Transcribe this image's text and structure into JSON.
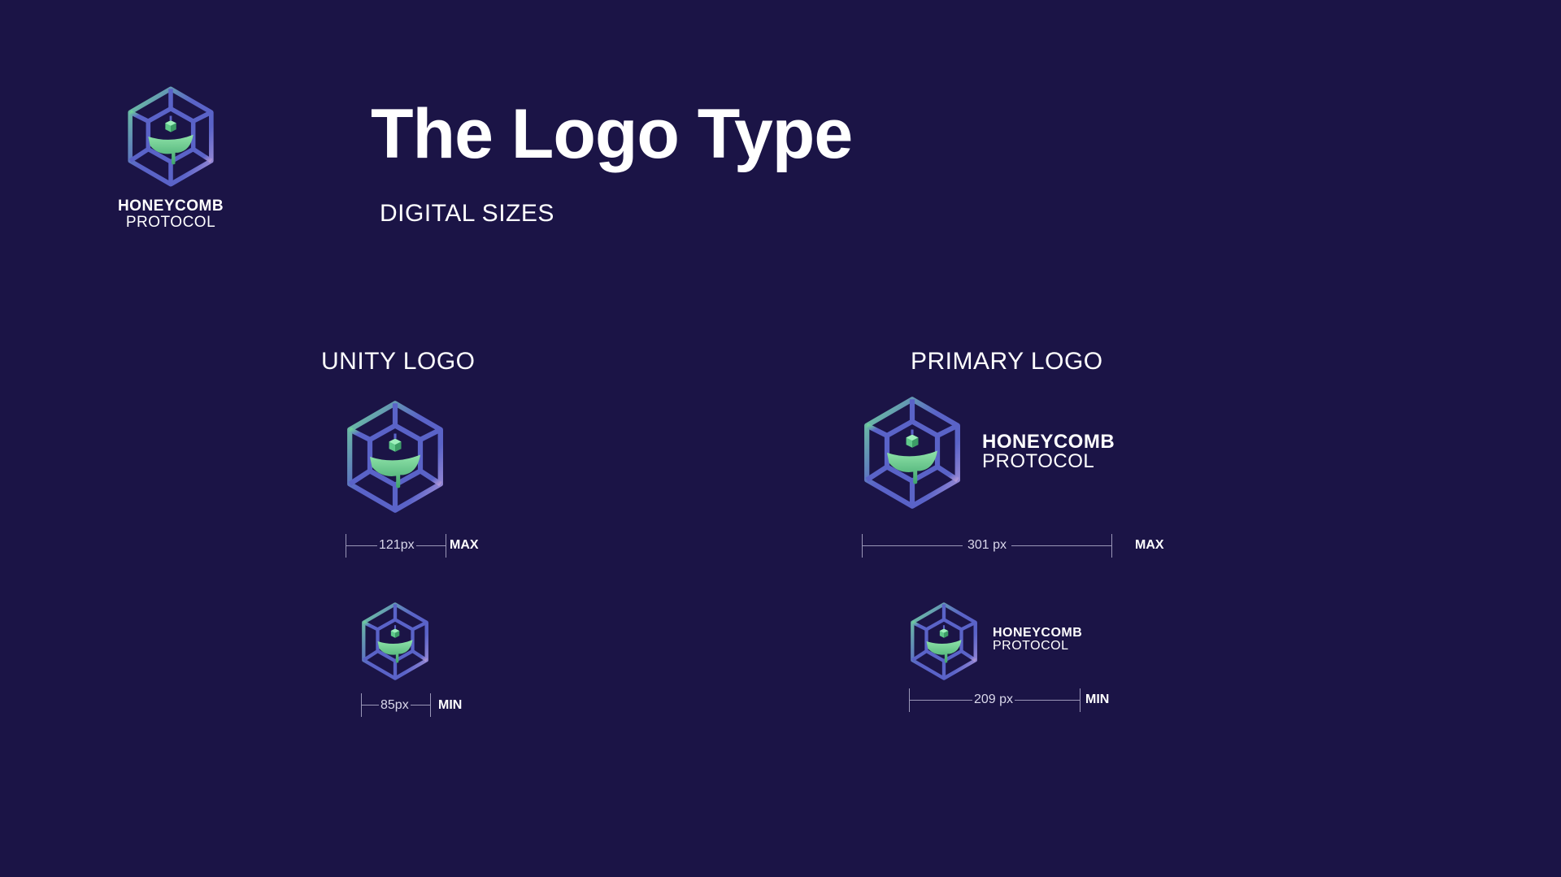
{
  "brand": {
    "name_line1": "HONEYCOMB",
    "name_line2": "PROTOCOL",
    "logo_icon": "honeycomb-hexagon-cube-icon"
  },
  "header": {
    "title": "The Logo Type",
    "subtitle": "DIGITAL SIZES"
  },
  "unity": {
    "heading": "UNITY LOGO",
    "max": {
      "size_label": "121px",
      "tag": "MAX"
    },
    "min": {
      "size_label": "85px",
      "tag": "MIN"
    }
  },
  "primary": {
    "heading": "PRIMARY LOGO",
    "max": {
      "size_label": "301 px",
      "tag": "MAX"
    },
    "min": {
      "size_label": "209 px",
      "tag": "MIN"
    }
  },
  "colors": {
    "background": "#1b1446",
    "hex_stroke_blue": "#5a63c8",
    "hex_stroke_green": "#6fd59a",
    "hex_stroke_lilac": "#a48fd6",
    "honey_green": "#5fc98a"
  }
}
